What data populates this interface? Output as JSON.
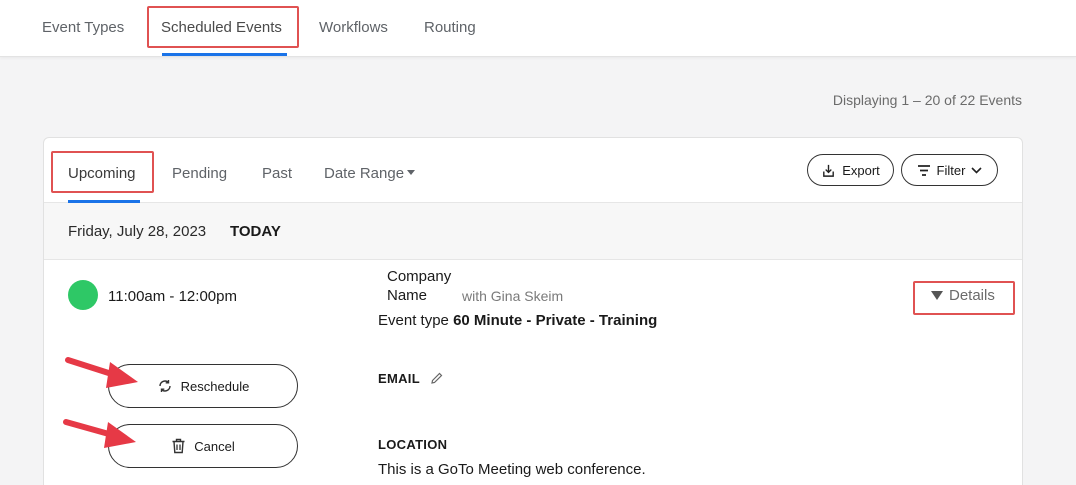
{
  "topnav": {
    "tabs": [
      {
        "label": "Event Types"
      },
      {
        "label": "Scheduled Events"
      },
      {
        "label": "Workflows"
      },
      {
        "label": "Routing"
      }
    ]
  },
  "summary": {
    "displaying": "Displaying 1 – 20 of 22 Events"
  },
  "subtabs": [
    {
      "label": "Upcoming"
    },
    {
      "label": "Pending"
    },
    {
      "label": "Past"
    },
    {
      "label": "Date Range"
    }
  ],
  "toolbar": {
    "export_label": "Export",
    "filter_label": "Filter"
  },
  "datebar": {
    "date": "Friday, July 28, 2023",
    "badge": "TODAY"
  },
  "event": {
    "status_color": "#2ec866",
    "time_range": "11:00am - 12:00pm",
    "company": "Company Name",
    "with": "with Gina Skeim",
    "event_type_prefix": "Event type",
    "event_type": "60 Minute - Private - Training",
    "details_label": "Details",
    "email_label": "EMAIL",
    "location_label": "LOCATION",
    "location_text": "This is a GoTo Meeting web conference."
  },
  "actions": {
    "reschedule_label": "Reschedule",
    "cancel_label": "Cancel"
  },
  "colors": {
    "accent": "#1a73e8",
    "highlight": "#e05252"
  }
}
